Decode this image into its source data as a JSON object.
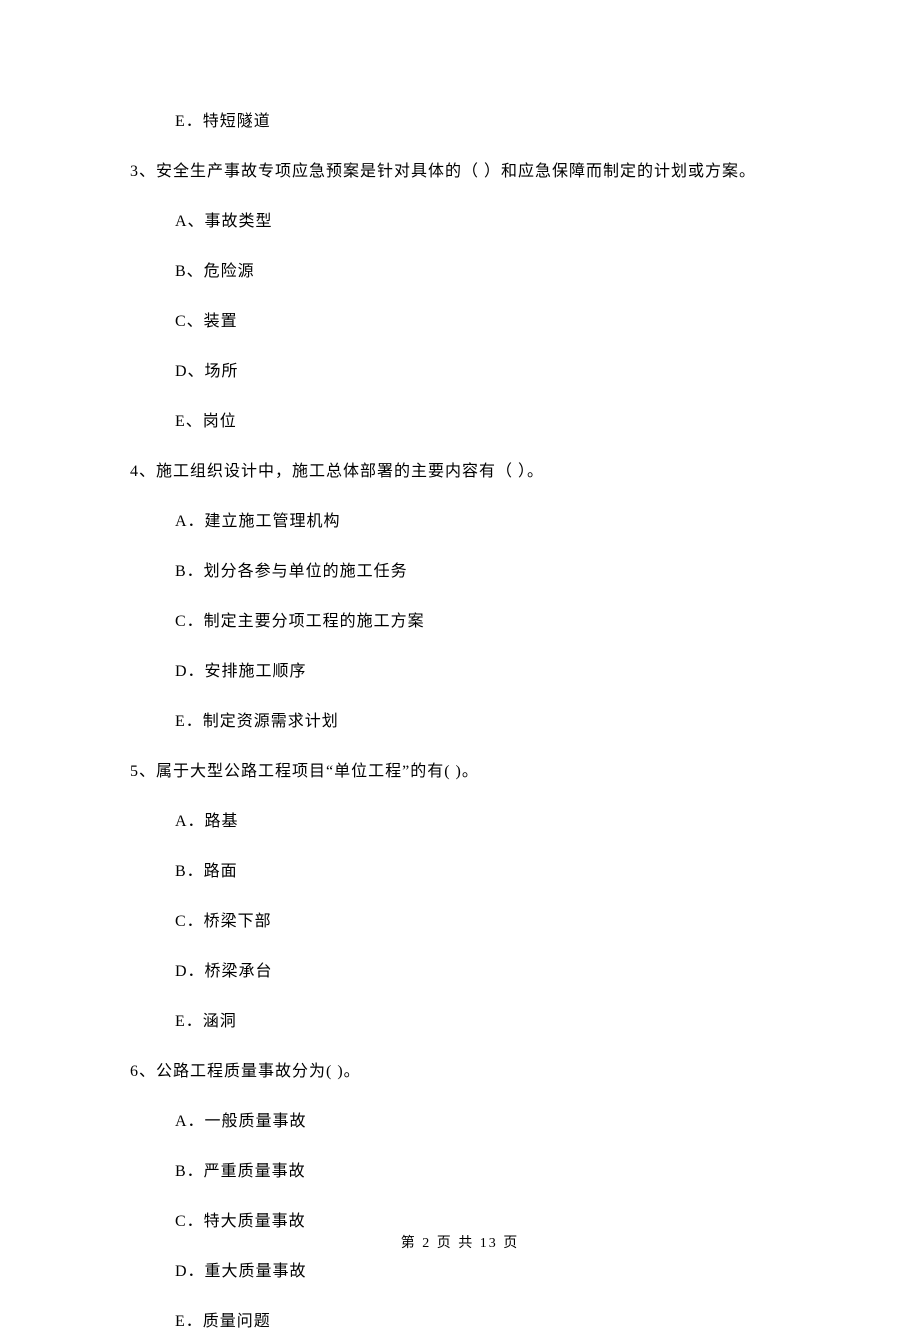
{
  "q2": {
    "optE": "E．特短隧道"
  },
  "q3": {
    "text": "3、安全生产事故专项应急预案是针对具体的（   ）和应急保障而制定的计划或方案。",
    "optA": "A、事故类型",
    "optB": "B、危险源",
    "optC": "C、装置",
    "optD": "D、场所",
    "optE": "E、岗位"
  },
  "q4": {
    "text": "4、施工组织设计中，施工总体部署的主要内容有（    ）。",
    "optA": "A．建立施工管理机构",
    "optB": "B．划分各参与单位的施工任务",
    "optC": "C．制定主要分项工程的施工方案",
    "optD": "D．安排施工顺序",
    "optE": "E．制定资源需求计划"
  },
  "q5": {
    "text": "5、属于大型公路工程项目“单位工程”的有(    )。",
    "optA": "A．路基",
    "optB": "B．路面",
    "optC": "C．桥梁下部",
    "optD": "D．桥梁承台",
    "optE": "E．涵洞"
  },
  "q6": {
    "text": "6、公路工程质量事故分为(    )。",
    "optA": "A．一般质量事故",
    "optB": "B．严重质量事故",
    "optC": "C．特大质量事故",
    "optD": "D．重大质量事故",
    "optE": "E．质量问题"
  },
  "footer": "第 2 页 共 13 页"
}
